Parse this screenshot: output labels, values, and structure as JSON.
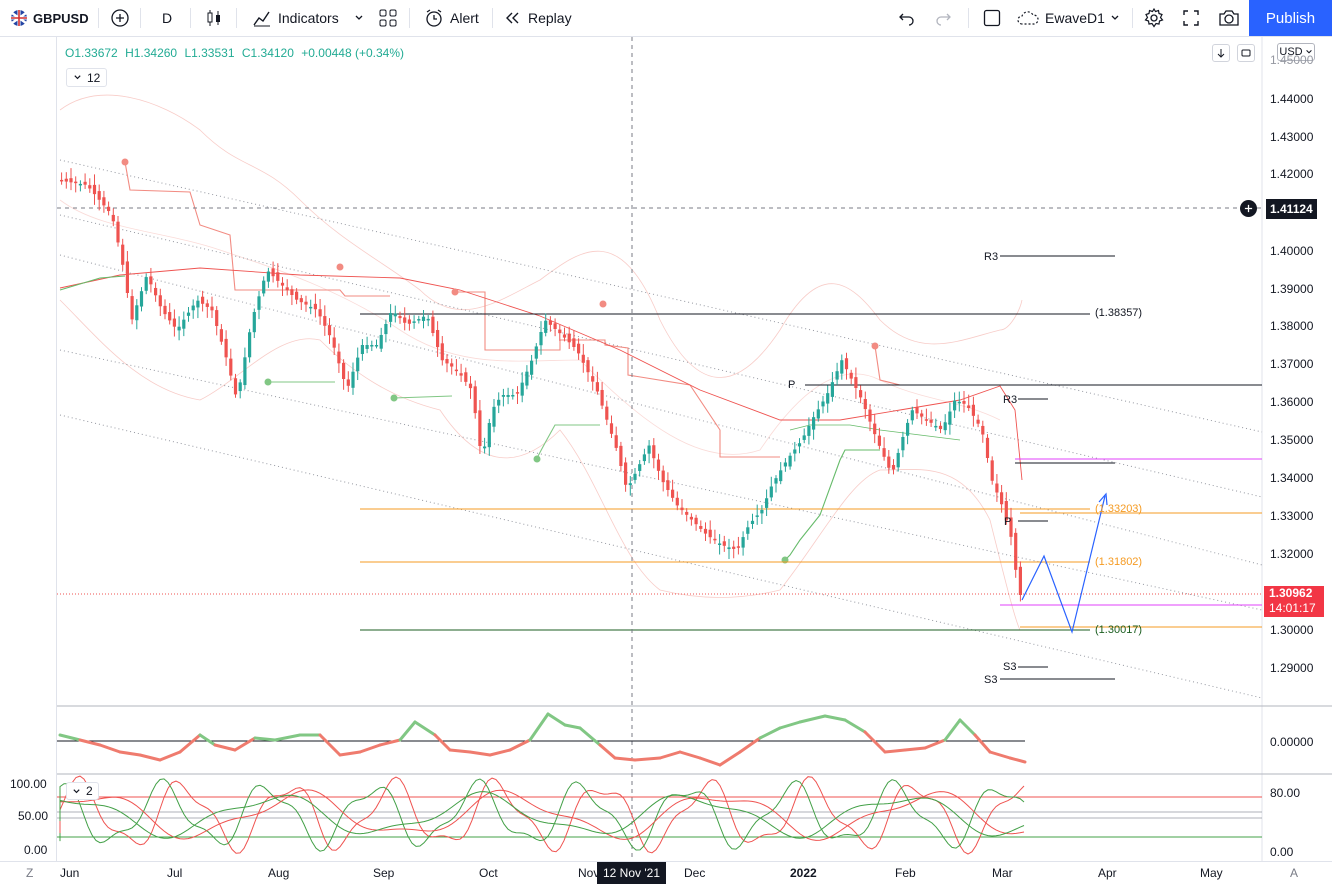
{
  "toolbar": {
    "symbol": "GBPUSD",
    "interval": "D",
    "indicators_label": "Indicators",
    "alert_label": "Alert",
    "replay_label": "Replay",
    "layout_name": "EwaveD1",
    "publish_label": "Publish"
  },
  "legend": {
    "open": "O1.33672",
    "high": "H1.34260",
    "low": "L1.33531",
    "close": "C1.34120",
    "change": "+0.00448 (+0.34%)",
    "collapsed_count": "12",
    "collapsed_count_2": "2"
  },
  "price_axis": {
    "currency": "USD",
    "ticks": [
      "1.45000",
      "1.44000",
      "1.43000",
      "1.42000",
      "1.40000",
      "1.39000",
      "1.38000",
      "1.37000",
      "1.36000",
      "1.35000",
      "1.34000",
      "1.33000",
      "1.32000",
      "1.30000",
      "1.29000"
    ],
    "crosshair_price": "1.41124",
    "last_price": "1.30962",
    "countdown": "14:01:17"
  },
  "levels": {
    "r3_a": "R3",
    "r3_b": "R3",
    "p_a": "P",
    "p_b": "P",
    "s3_a": "S3",
    "s3_b": "S3",
    "l1": "(1.38357)",
    "l2": "(1.33203)",
    "l3": "(1.31802)",
    "l4": "(1.30017)"
  },
  "osc1_axis": {
    "zero": "0.00000"
  },
  "osc2_axis": {
    "left_ticks": [
      "100.00",
      "50.00",
      "0.00"
    ],
    "right_ticks": [
      "80.00",
      "0.00"
    ]
  },
  "time_axis": {
    "months": [
      "Jun",
      "Jul",
      "Aug",
      "Sep",
      "Oct",
      "Nov",
      "Dec",
      "2022",
      "Feb",
      "Mar",
      "Apr",
      "May"
    ],
    "crosshair_date": "12 Nov '21",
    "left_btn": "Z",
    "right_btn": "A"
  },
  "colors": {
    "up": "#26a69a",
    "down": "#ef5350",
    "accent": "#2962ff",
    "orange": "#f5a623",
    "magenta": "#e040fb"
  },
  "chart_data": {
    "type": "candlestick",
    "symbol": "GBPUSD",
    "timeframe": "D",
    "ylim": [
      1.283,
      1.45
    ],
    "key_levels": [
      1.38357,
      1.33203,
      1.31802,
      1.30017
    ],
    "last_price": 1.30962
  }
}
